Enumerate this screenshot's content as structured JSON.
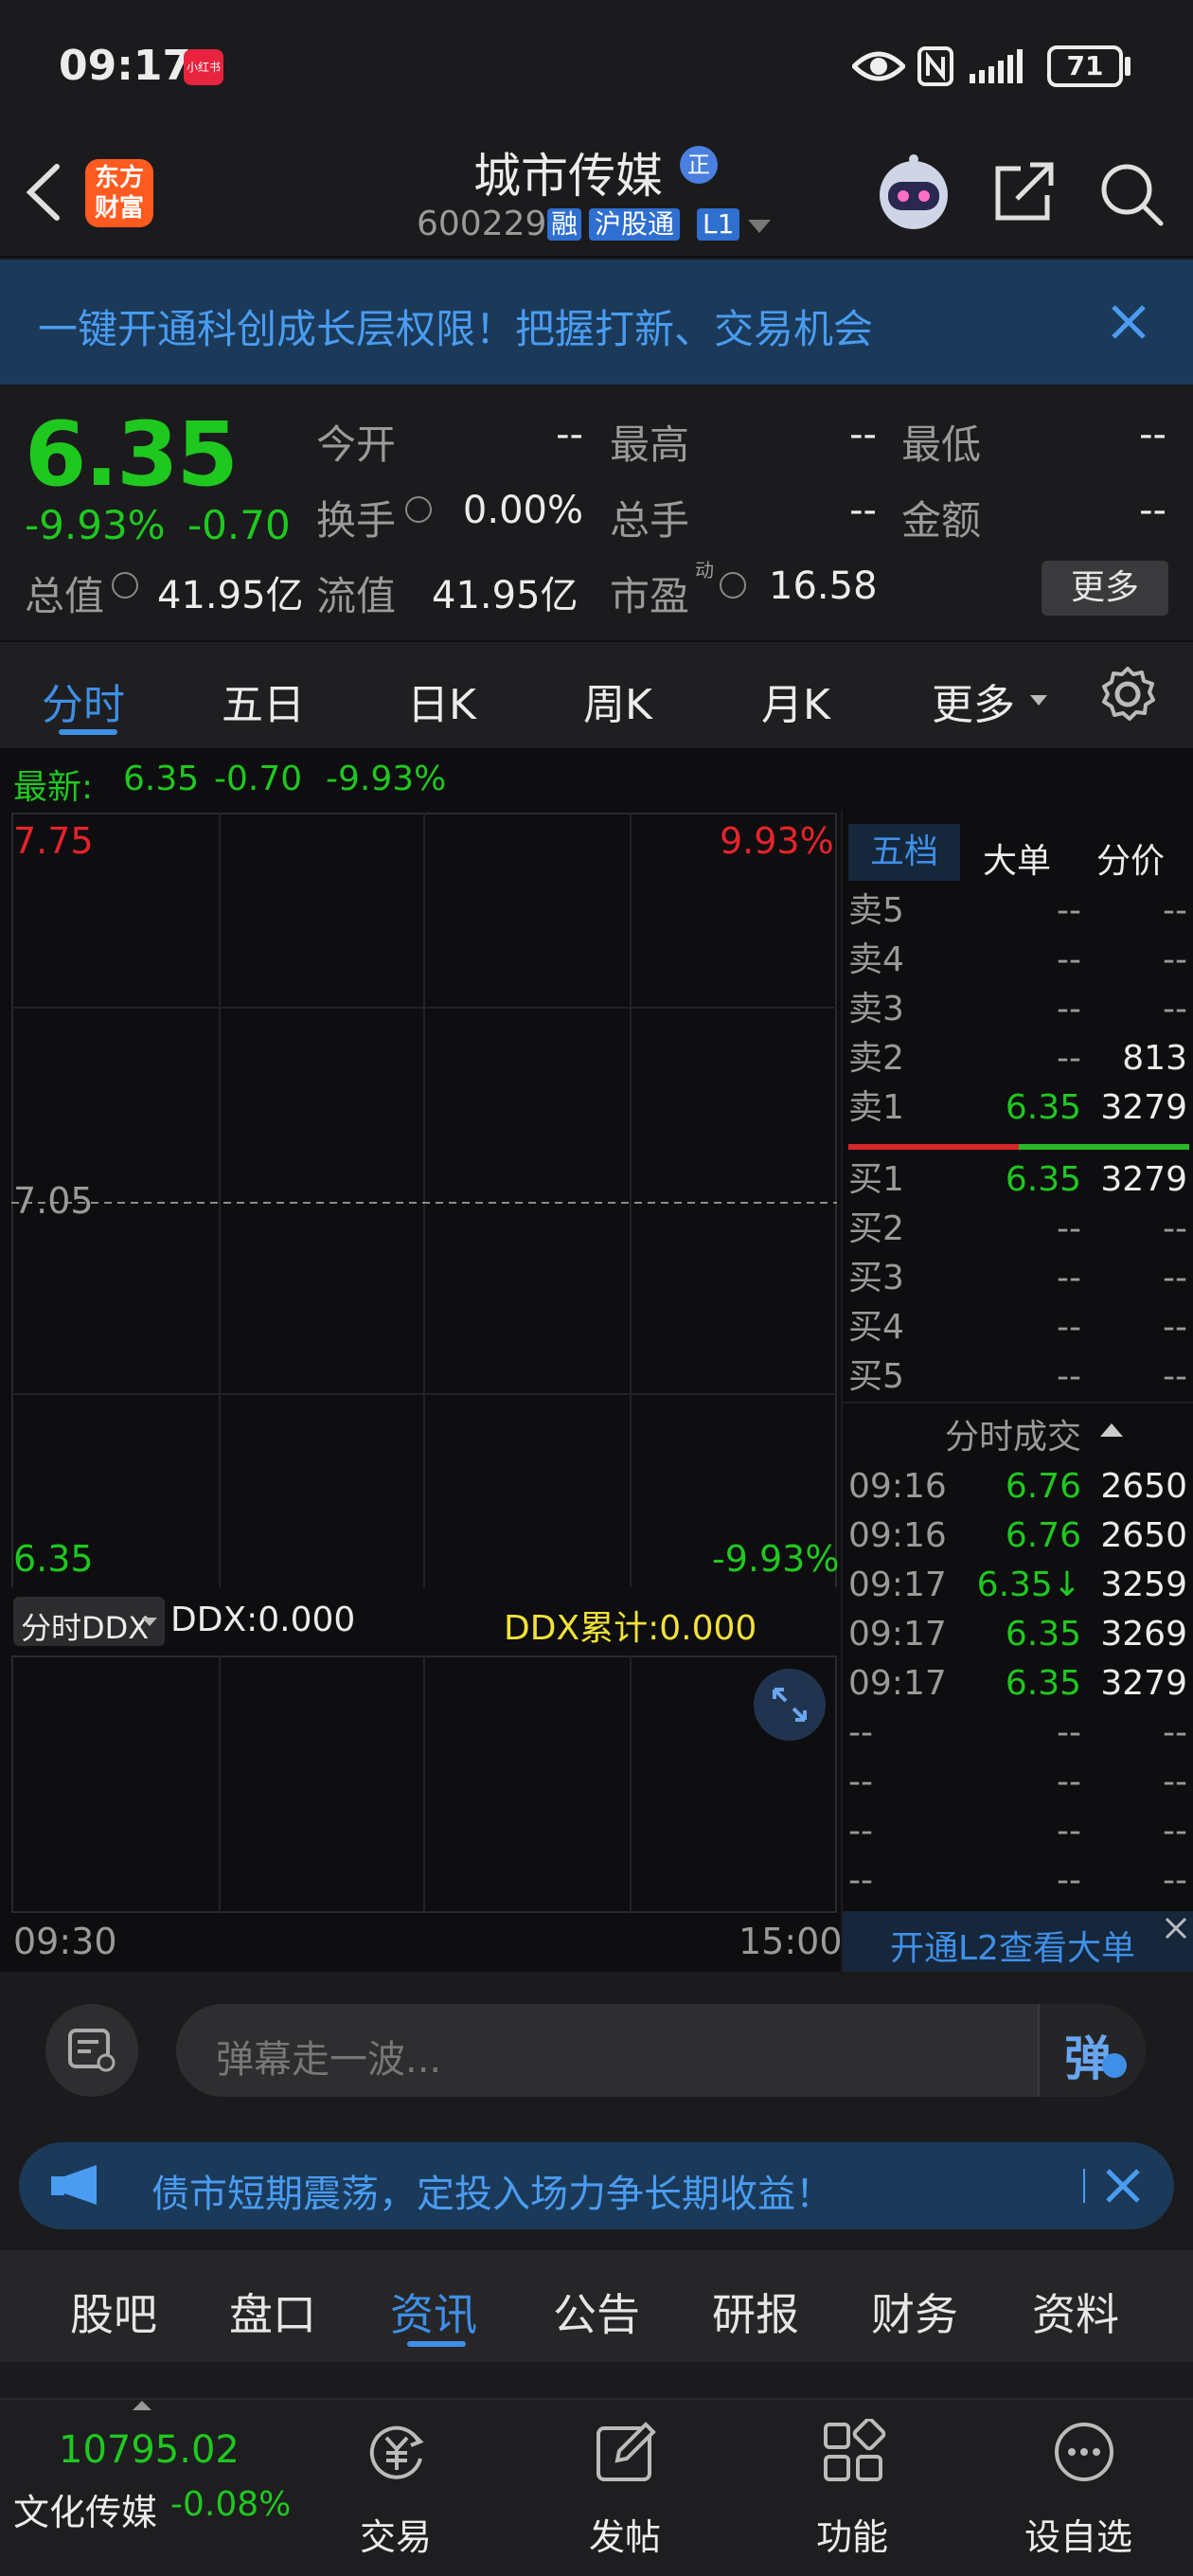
{
  "status_bar": {
    "time": "09:17",
    "app_badge": "小红书",
    "battery": "71"
  },
  "header": {
    "logo_line1": "东方",
    "logo_line2": "财富",
    "title": "城市传媒",
    "title_badge": "正",
    "code": "600229",
    "tag_rong": "融",
    "tag_hgt": "沪股通",
    "tag_l1": "L1"
  },
  "promo_banner": {
    "text": "一键开通科创成长层权限！把握打新、交易机会"
  },
  "quote": {
    "price": "6.35",
    "change_pct": "-9.93%",
    "change": "-0.70",
    "labels": {
      "open": "今开",
      "high": "最高",
      "low": "最低",
      "turnover": "换手",
      "volume": "总手",
      "amount": "金额",
      "total_value": "总值",
      "float_value": "流值",
      "pe": "市盈",
      "pe_sup": "动"
    },
    "values": {
      "open": "--",
      "high": "--",
      "low": "--",
      "turnover": "0.00%",
      "volume": "--",
      "amount": "--",
      "total_value": "41.95亿",
      "float_value": "41.95亿",
      "pe": "16.58"
    },
    "more_button": "更多"
  },
  "chart_tabs": [
    "分时",
    "五日",
    "日K",
    "周K",
    "月K",
    "更多"
  ],
  "latest": {
    "label": "最新:",
    "price": "6.35",
    "change": "-0.70",
    "pct": "-9.93%"
  },
  "chart_data": {
    "type": "line",
    "title": "",
    "y_top": "7.75",
    "y_mid": "7.05",
    "y_bottom": "6.35",
    "pct_top": "9.93%",
    "pct_bottom": "-9.93%",
    "ylim": [
      6.35,
      7.75
    ],
    "reference": 7.05,
    "x_start": "09:30",
    "x_end": "15:00",
    "series": []
  },
  "ddx": {
    "selector": "分时DDX",
    "ddx_text": "DDX:0.000",
    "ddx_cum_text": "DDX累计:0.000"
  },
  "order_book": {
    "tabs": [
      "五档",
      "大单",
      "分价"
    ],
    "asks": [
      {
        "label": "卖5",
        "price": "--",
        "vol": "--"
      },
      {
        "label": "卖4",
        "price": "--",
        "vol": "--"
      },
      {
        "label": "卖3",
        "price": "--",
        "vol": "--"
      },
      {
        "label": "卖2",
        "price": "--",
        "vol": "813"
      },
      {
        "label": "卖1",
        "price": "6.35",
        "vol": "3279"
      }
    ],
    "bids": [
      {
        "label": "买1",
        "price": "6.35",
        "vol": "3279"
      },
      {
        "label": "买2",
        "price": "--",
        "vol": "--"
      },
      {
        "label": "买3",
        "price": "--",
        "vol": "--"
      },
      {
        "label": "买4",
        "price": "--",
        "vol": "--"
      },
      {
        "label": "买5",
        "price": "--",
        "vol": "--"
      }
    ],
    "ratio_bar": {
      "red_fraction": 0.5,
      "red": "#d8262a",
      "green": "#29b829"
    }
  },
  "ticks": {
    "title": "分时成交",
    "rows": [
      {
        "time": "09:16",
        "price": "6.76",
        "vol": "2650"
      },
      {
        "time": "09:16",
        "price": "6.76",
        "vol": "2650"
      },
      {
        "time": "09:17",
        "price": "6.35↓",
        "vol": "3259"
      },
      {
        "time": "09:17",
        "price": "6.35",
        "vol": "3269"
      },
      {
        "time": "09:17",
        "price": "6.35",
        "vol": "3279"
      },
      {
        "time": "--",
        "price": "--",
        "vol": "--"
      },
      {
        "time": "--",
        "price": "--",
        "vol": "--"
      },
      {
        "time": "--",
        "price": "--",
        "vol": "--"
      },
      {
        "time": "--",
        "price": "--",
        "vol": "--"
      }
    ],
    "l2_link": "开通L2查看大单"
  },
  "danmu": {
    "placeholder": "弹幕走一波...",
    "send": "弹"
  },
  "notice": {
    "text": "债市短期震荡，定投入场力争长期收益！"
  },
  "sub_tabs": [
    "股吧",
    "盘口",
    "资讯",
    "公告",
    "研报",
    "财务",
    "资料"
  ],
  "bottom_nav": {
    "index_value": "10795.02",
    "index_name": "文化传媒",
    "index_change": "-0.08%",
    "items": [
      "交易",
      "发帖",
      "功能",
      "设自选"
    ]
  },
  "colors": {
    "up": "#e8232b",
    "down": "#1fc81f",
    "accent": "#3f8fe6",
    "brand_orange": "#ff5a1f"
  }
}
